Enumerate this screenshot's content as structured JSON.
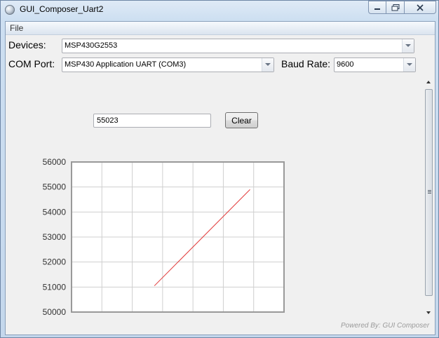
{
  "window": {
    "title": "GUI_Composer_Uart2"
  },
  "menu": {
    "file": "File"
  },
  "devices": {
    "label": "Devices:",
    "value": "MSP430G2553"
  },
  "com_port": {
    "label": "COM Port:",
    "value": "MSP430 Application UART (COM3)"
  },
  "baud_rate": {
    "label": "Baud Rate:",
    "value": "9600"
  },
  "reading": {
    "value": "55023"
  },
  "clear_button": {
    "label": "Clear"
  },
  "footer": {
    "text": "Powered By: GUI Composer"
  },
  "colors": {
    "series": "#e23b3b",
    "grid": "#cfcfcf",
    "frame": "#999999"
  },
  "chart_data": {
    "type": "line",
    "ylim": [
      50000,
      56000
    ],
    "yticks": [
      "50000",
      "51000",
      "52000",
      "53000",
      "54000",
      "55000",
      "56000"
    ],
    "series": [
      {
        "points": [
          [
            0.39,
            51050
          ],
          [
            0.84,
            54900
          ]
        ]
      }
    ],
    "grid": true,
    "xlabel": "",
    "ylabel": ""
  }
}
